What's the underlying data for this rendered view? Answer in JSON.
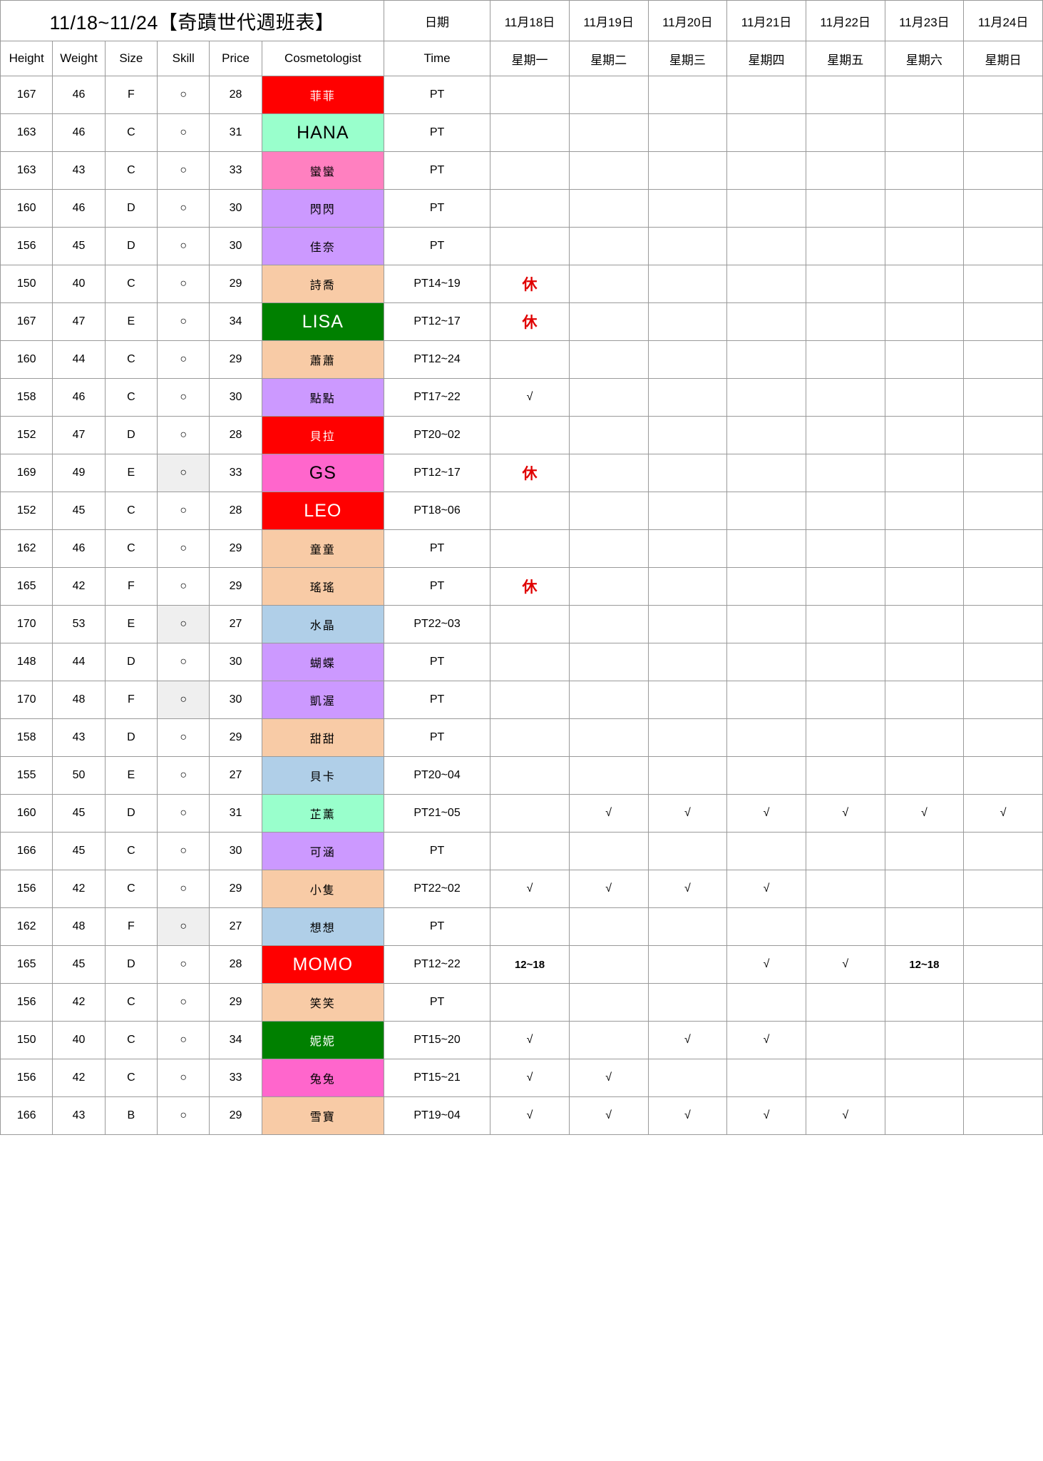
{
  "title": "11/18~11/24【奇蹟世代週班表】",
  "header": {
    "date_label": "日期",
    "dates": [
      "11月18日",
      "11月19日",
      "11月20日",
      "11月21日",
      "11月22日",
      "11月23日",
      "11月24日"
    ],
    "weekdays": [
      "星期一",
      "星期二",
      "星期三",
      "星期四",
      "星期五",
      "星期六",
      "星期日"
    ],
    "columns": [
      "Height",
      "Weight",
      "Size",
      "Skill",
      "Price",
      "Cosmetologist",
      "Time"
    ]
  },
  "colors": {
    "red": "#FF0000",
    "mint": "#99FFCC",
    "pink": "#FF80C0",
    "violet": "#CC99FF",
    "peach": "#F8CBA6",
    "green": "#008000",
    "hotpink": "#FF66CC",
    "blue": "#B0CFE8",
    "white_text": "#FFFFFF",
    "black_text": "#000000",
    "rest_red": "#E00000",
    "skill_shade": "#EFEFEF"
  },
  "rows": [
    {
      "height": "167",
      "weight": "46",
      "size": "F",
      "skill": "○",
      "skill_shaded": false,
      "name": "菲菲",
      "name_bg": "#FF0000",
      "name_fg": "#FFFFFF",
      "latin": false,
      "time": "PT",
      "days": [
        "",
        "",
        "",
        "",
        "",
        "",
        ""
      ]
    },
    {
      "height": "163",
      "weight": "46",
      "size": "C",
      "skill": "○",
      "skill_shaded": false,
      "name": "HANA",
      "name_bg": "#99FFCC",
      "name_fg": "#000000",
      "latin": true,
      "time": "PT",
      "days": [
        "",
        "",
        "",
        "",
        "",
        "",
        ""
      ]
    },
    {
      "height": "163",
      "weight": "43",
      "size": "C",
      "skill": "○",
      "skill_shaded": false,
      "name": "蠻蠻",
      "name_bg": "#FF80C0",
      "name_fg": "#000000",
      "latin": false,
      "time": "PT",
      "days": [
        "",
        "",
        "",
        "",
        "",
        "",
        ""
      ]
    },
    {
      "height": "160",
      "weight": "46",
      "size": "D",
      "skill": "○",
      "skill_shaded": false,
      "name": "閃閃",
      "name_bg": "#CC99FF",
      "name_fg": "#000000",
      "latin": false,
      "time": "PT",
      "days": [
        "",
        "",
        "",
        "",
        "",
        "",
        ""
      ]
    },
    {
      "height": "156",
      "weight": "45",
      "size": "D",
      "skill": "○",
      "skill_shaded": false,
      "name": "佳奈",
      "name_bg": "#CC99FF",
      "name_fg": "#000000",
      "latin": false,
      "time": "PT",
      "days": [
        "",
        "",
        "",
        "",
        "",
        "",
        ""
      ]
    },
    {
      "height": "150",
      "weight": "40",
      "size": "C",
      "skill": "○",
      "skill_shaded": false,
      "name": "詩喬",
      "name_bg": "#F8CBA6",
      "name_fg": "#000000",
      "latin": false,
      "time": "PT14~19",
      "days": [
        "休",
        "",
        "",
        "",
        "",
        "",
        ""
      ]
    },
    {
      "height": "167",
      "weight": "47",
      "size": "E",
      "skill": "○",
      "skill_shaded": false,
      "name": "LISA",
      "name_bg": "#008000",
      "name_fg": "#FFFFFF",
      "latin": true,
      "time": "PT12~17",
      "days": [
        "休",
        "",
        "",
        "",
        "",
        "",
        ""
      ]
    },
    {
      "height": "160",
      "weight": "44",
      "size": "C",
      "skill": "○",
      "skill_shaded": false,
      "name": "蕭蕭",
      "name_bg": "#F8CBA6",
      "name_fg": "#000000",
      "latin": false,
      "time": "PT12~24",
      "days": [
        "",
        "",
        "",
        "",
        "",
        "",
        ""
      ]
    },
    {
      "height": "158",
      "weight": "46",
      "size": "C",
      "skill": "○",
      "skill_shaded": false,
      "name": "點點",
      "name_bg": "#CC99FF",
      "name_fg": "#000000",
      "latin": false,
      "time": "PT17~22",
      "days": [
        "√",
        "",
        "",
        "",
        "",
        "",
        ""
      ]
    },
    {
      "height": "152",
      "weight": "47",
      "size": "D",
      "skill": "○",
      "skill_shaded": false,
      "name": "貝拉",
      "name_bg": "#FF0000",
      "name_fg": "#FFFFFF",
      "latin": false,
      "time": "PT20~02",
      "days": [
        "",
        "",
        "",
        "",
        "",
        "",
        ""
      ]
    },
    {
      "height": "169",
      "weight": "49",
      "size": "E",
      "skill": "○",
      "skill_shaded": true,
      "name": "GS",
      "name_bg": "#FF66CC",
      "name_fg": "#000000",
      "latin": true,
      "time": "PT12~17",
      "days": [
        "休",
        "",
        "",
        "",
        "",
        "",
        ""
      ]
    },
    {
      "height": "152",
      "weight": "45",
      "size": "C",
      "skill": "○",
      "skill_shaded": false,
      "name": "LEO",
      "name_bg": "#FF0000",
      "name_fg": "#FFFFFF",
      "latin": true,
      "time": "PT18~06",
      "days": [
        "",
        "",
        "",
        "",
        "",
        "",
        ""
      ]
    },
    {
      "height": "162",
      "weight": "46",
      "size": "C",
      "skill": "○",
      "skill_shaded": false,
      "name": "童童",
      "name_bg": "#F8CBA6",
      "name_fg": "#000000",
      "latin": false,
      "time": "PT",
      "days": [
        "",
        "",
        "",
        "",
        "",
        "",
        ""
      ]
    },
    {
      "height": "165",
      "weight": "42",
      "size": "F",
      "skill": "○",
      "skill_shaded": false,
      "name": "瑤瑤",
      "name_bg": "#F8CBA6",
      "name_fg": "#000000",
      "latin": false,
      "time": "PT",
      "days": [
        "休",
        "",
        "",
        "",
        "",
        "",
        ""
      ]
    },
    {
      "height": "170",
      "weight": "53",
      "size": "E",
      "skill": "○",
      "skill_shaded": true,
      "name": "水晶",
      "name_bg": "#B0CFE8",
      "name_fg": "#000000",
      "latin": false,
      "time": "PT22~03",
      "days": [
        "",
        "",
        "",
        "",
        "",
        "",
        ""
      ]
    },
    {
      "height": "148",
      "weight": "44",
      "size": "D",
      "skill": "○",
      "skill_shaded": false,
      "name": "蝴蝶",
      "name_bg": "#CC99FF",
      "name_fg": "#000000",
      "latin": false,
      "time": "PT",
      "days": [
        "",
        "",
        "",
        "",
        "",
        "",
        ""
      ]
    },
    {
      "height": "170",
      "weight": "48",
      "size": "F",
      "skill": "○",
      "skill_shaded": true,
      "name": "凱渥",
      "name_bg": "#CC99FF",
      "name_fg": "#000000",
      "latin": false,
      "time": "PT",
      "days": [
        "",
        "",
        "",
        "",
        "",
        "",
        ""
      ]
    },
    {
      "height": "158",
      "weight": "43",
      "size": "D",
      "skill": "○",
      "skill_shaded": false,
      "name": "甜甜",
      "name_bg": "#F8CBA6",
      "name_fg": "#000000",
      "latin": false,
      "time": "PT",
      "days": [
        "",
        "",
        "",
        "",
        "",
        "",
        ""
      ]
    },
    {
      "height": "155",
      "weight": "50",
      "size": "E",
      "skill": "○",
      "skill_shaded": false,
      "name": "貝卡",
      "name_bg": "#B0CFE8",
      "name_fg": "#000000",
      "latin": false,
      "time": "PT20~04",
      "days": [
        "",
        "",
        "",
        "",
        "",
        "",
        ""
      ]
    },
    {
      "height": "160",
      "weight": "45",
      "size": "D",
      "skill": "○",
      "skill_shaded": false,
      "name": "芷薰",
      "name_bg": "#99FFCC",
      "name_fg": "#000000",
      "latin": false,
      "time": "PT21~05",
      "days": [
        "",
        "√",
        "√",
        "√",
        "√",
        "√",
        "√"
      ]
    },
    {
      "height": "166",
      "weight": "45",
      "size": "C",
      "skill": "○",
      "skill_shaded": false,
      "name": "可涵",
      "name_bg": "#CC99FF",
      "name_fg": "#000000",
      "latin": false,
      "time": "PT",
      "days": [
        "",
        "",
        "",
        "",
        "",
        "",
        ""
      ]
    },
    {
      "height": "156",
      "weight": "42",
      "size": "C",
      "skill": "○",
      "skill_shaded": false,
      "name": "小隻",
      "name_bg": "#F8CBA6",
      "name_fg": "#000000",
      "latin": false,
      "time": "PT22~02",
      "days": [
        "√",
        "√",
        "√",
        "√",
        "",
        "",
        ""
      ]
    },
    {
      "height": "162",
      "weight": "48",
      "size": "F",
      "skill": "○",
      "skill_shaded": true,
      "name": "想想",
      "name_bg": "#B0CFE8",
      "name_fg": "#000000",
      "latin": false,
      "time": "PT",
      "days": [
        "",
        "",
        "",
        "",
        "",
        "",
        ""
      ]
    },
    {
      "height": "165",
      "weight": "45",
      "size": "D",
      "skill": "○",
      "skill_shaded": false,
      "name": "MOMO",
      "name_bg": "#FF0000",
      "name_fg": "#FFFFFF",
      "latin": true,
      "time": "PT12~22",
      "days": [
        "12~18",
        "",
        "",
        "√",
        "√",
        "12~18",
        ""
      ]
    },
    {
      "height": "156",
      "weight": "42",
      "size": "C",
      "skill": "○",
      "skill_shaded": false,
      "name": "笑笑",
      "name_bg": "#F8CBA6",
      "name_fg": "#000000",
      "latin": false,
      "time": "PT",
      "days": [
        "",
        "",
        "",
        "",
        "",
        "",
        ""
      ]
    },
    {
      "height": "150",
      "weight": "40",
      "size": "C",
      "skill": "○",
      "skill_shaded": false,
      "name": "妮妮",
      "name_bg": "#008000",
      "name_fg": "#FFFFFF",
      "latin": false,
      "time": "PT15~20",
      "days": [
        "√",
        "",
        "√",
        "√",
        "",
        "",
        ""
      ]
    },
    {
      "height": "156",
      "weight": "42",
      "size": "C",
      "skill": "○",
      "skill_shaded": false,
      "name": "兔兔",
      "name_bg": "#FF66CC",
      "name_fg": "#000000",
      "latin": false,
      "time": "PT15~21",
      "days": [
        "√",
        "√",
        "",
        "",
        "",
        "",
        ""
      ]
    },
    {
      "height": "166",
      "weight": "43",
      "size": "B",
      "skill": "○",
      "skill_shaded": false,
      "name": "雪寶",
      "name_bg": "#F8CBA6",
      "name_fg": "#000000",
      "latin": false,
      "time": "PT19~04",
      "days": [
        "√",
        "√",
        "√",
        "√",
        "√",
        "",
        ""
      ]
    }
  ]
}
